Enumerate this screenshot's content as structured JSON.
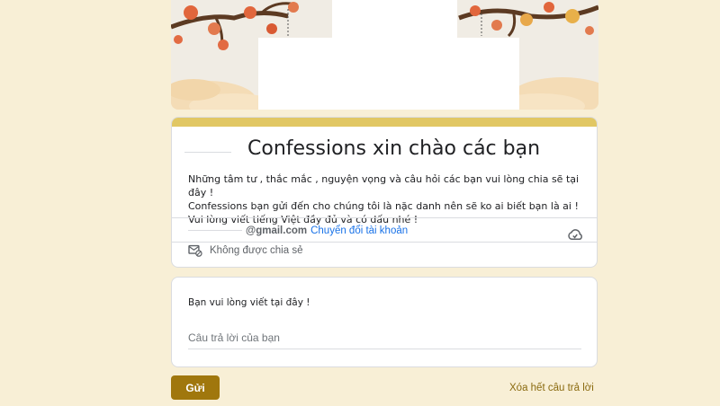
{
  "form": {
    "title": "Confessions xin chào các bạn",
    "description_lines": [
      "Những tâm tư , thắc mắc , nguyện vọng và câu hỏi các bạn vui lòng chia sẽ tại đây !",
      "Confessions bạn gửi đến cho chúng tôi là nặc danh nên sẽ ko ai biết bạn là ai !",
      "Vui lòng viết tiếng Việt đầy đủ và có dấu nhé !"
    ],
    "accent_color": "#e1c764"
  },
  "account": {
    "email": "@gmail.com",
    "switch_label": "Chuyển đổi tài khoản",
    "not_shared_label": "Không được chia sẻ"
  },
  "question": {
    "title": "Bạn vui lòng viết tại đây !",
    "placeholder": "Câu trả lời của bạn"
  },
  "actions": {
    "submit_label": "Gửi",
    "clear_label": "Xóa hết câu trả lời",
    "submit_color": "#a0770d"
  },
  "icons": {
    "cloud": "cloud-icon",
    "not_shared": "mail-not-shared-icon"
  }
}
